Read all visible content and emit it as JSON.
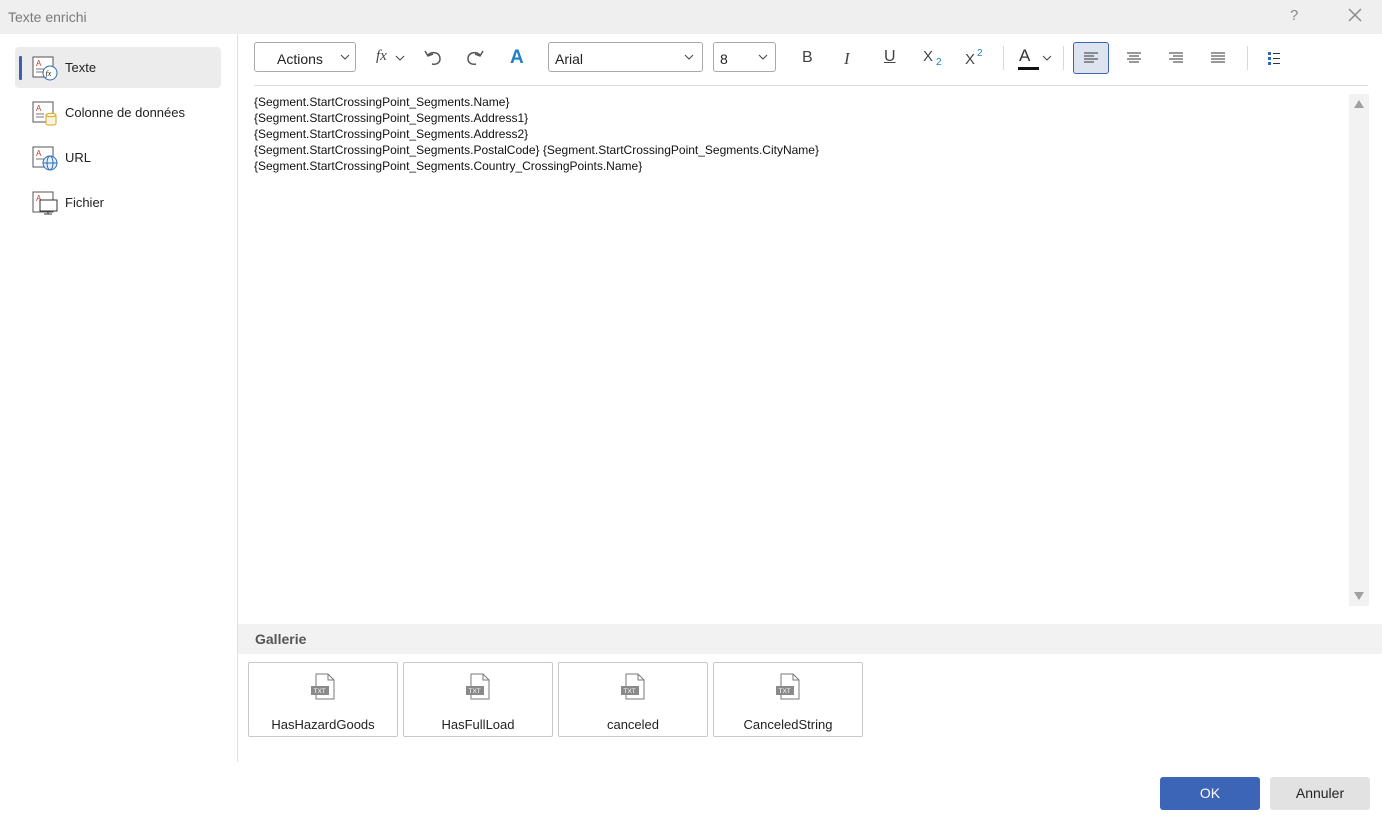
{
  "window": {
    "title": "Texte enrichi",
    "help": "?"
  },
  "sidebar": {
    "items": [
      {
        "label": "Texte",
        "active": true
      },
      {
        "label": "Colonne de données",
        "active": false
      },
      {
        "label": "URL",
        "active": false
      },
      {
        "label": "Fichier",
        "active": false
      }
    ]
  },
  "toolbar": {
    "actions_label": "Actions",
    "fx_label": "fx",
    "font_name": "Arial",
    "font_size": "8",
    "bold": "B",
    "italic": "I",
    "underline": "U",
    "subscript": "X",
    "subscript_mark": "2",
    "superscript": "X",
    "superscript_mark": "2",
    "font_color_letter": "A",
    "accent": "#1f7fc7"
  },
  "editor": {
    "lines": [
      "{Segment.StartCrossingPoint_Segments.Name}",
      "{Segment.StartCrossingPoint_Segments.Address1}",
      "{Segment.StartCrossingPoint_Segments.Address2}",
      "{Segment.StartCrossingPoint_Segments.PostalCode} {Segment.StartCrossingPoint_Segments.CityName}",
      "{Segment.StartCrossingPoint_Segments.Country_CrossingPoints.Name}"
    ]
  },
  "gallery": {
    "title": "Gallerie",
    "icon_text": "TXT",
    "items": [
      "HasHazardGoods",
      "HasFullLoad",
      "canceled",
      "CanceledString"
    ]
  },
  "footer": {
    "ok_label": "OK",
    "cancel_label": "Annuler"
  }
}
